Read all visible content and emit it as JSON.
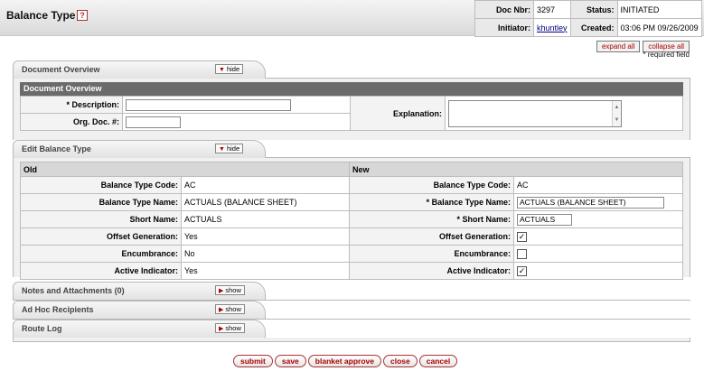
{
  "header": {
    "title": "Balance Type",
    "help_icon": "?",
    "doc_nbr_label": "Doc Nbr:",
    "doc_nbr": "3297",
    "status_label": "Status:",
    "status": "INITIATED",
    "initiator_label": "Initiator:",
    "initiator": "khuntley",
    "created_label": "Created:",
    "created": "03:06 PM 09/26/2009"
  },
  "top_buttons": {
    "expand_all": "expand all",
    "collapse_all": "collapse all",
    "required_note": "* required field"
  },
  "document_overview": {
    "tab_title": "Document Overview",
    "toggle": "hide",
    "section_title": "Document Overview",
    "description_label": "* Description:",
    "description_value": "",
    "org_doc_label": "Org. Doc. #:",
    "org_doc_value": "",
    "explanation_label": "Explanation:"
  },
  "edit_balance_type": {
    "tab_title": "Edit Balance Type",
    "toggle": "hide",
    "old_header": "Old",
    "new_header": "New",
    "rows": [
      {
        "label": "Balance Type Code:",
        "old": "AC",
        "new_label": "Balance Type Code:",
        "new": "AC"
      },
      {
        "label": "Balance Type Name:",
        "old": "ACTUALS (BALANCE SHEET)",
        "new_label": "* Balance Type Name:",
        "new": "ACTUALS (BALANCE SHEET)"
      },
      {
        "label": "Short Name:",
        "old": "ACTUALS",
        "new_label": "* Short Name:",
        "new": "ACTUALS"
      },
      {
        "label": "Offset Generation:",
        "old": "Yes",
        "new_label": "Offset Generation:",
        "new": "✓"
      },
      {
        "label": "Encumbrance:",
        "old": "No",
        "new_label": "Encumbrance:",
        "new": ""
      },
      {
        "label": "Active Indicator:",
        "old": "Yes",
        "new_label": "Active Indicator:",
        "new": "✓"
      }
    ]
  },
  "collapsed_tabs": [
    {
      "title": "Notes and Attachments (0)",
      "toggle": "show"
    },
    {
      "title": "Ad Hoc Recipients",
      "toggle": "show"
    },
    {
      "title": "Route Log",
      "toggle": "show"
    }
  ],
  "bottom_buttons": [
    "submit",
    "save",
    "blanket approve",
    "close",
    "cancel"
  ]
}
